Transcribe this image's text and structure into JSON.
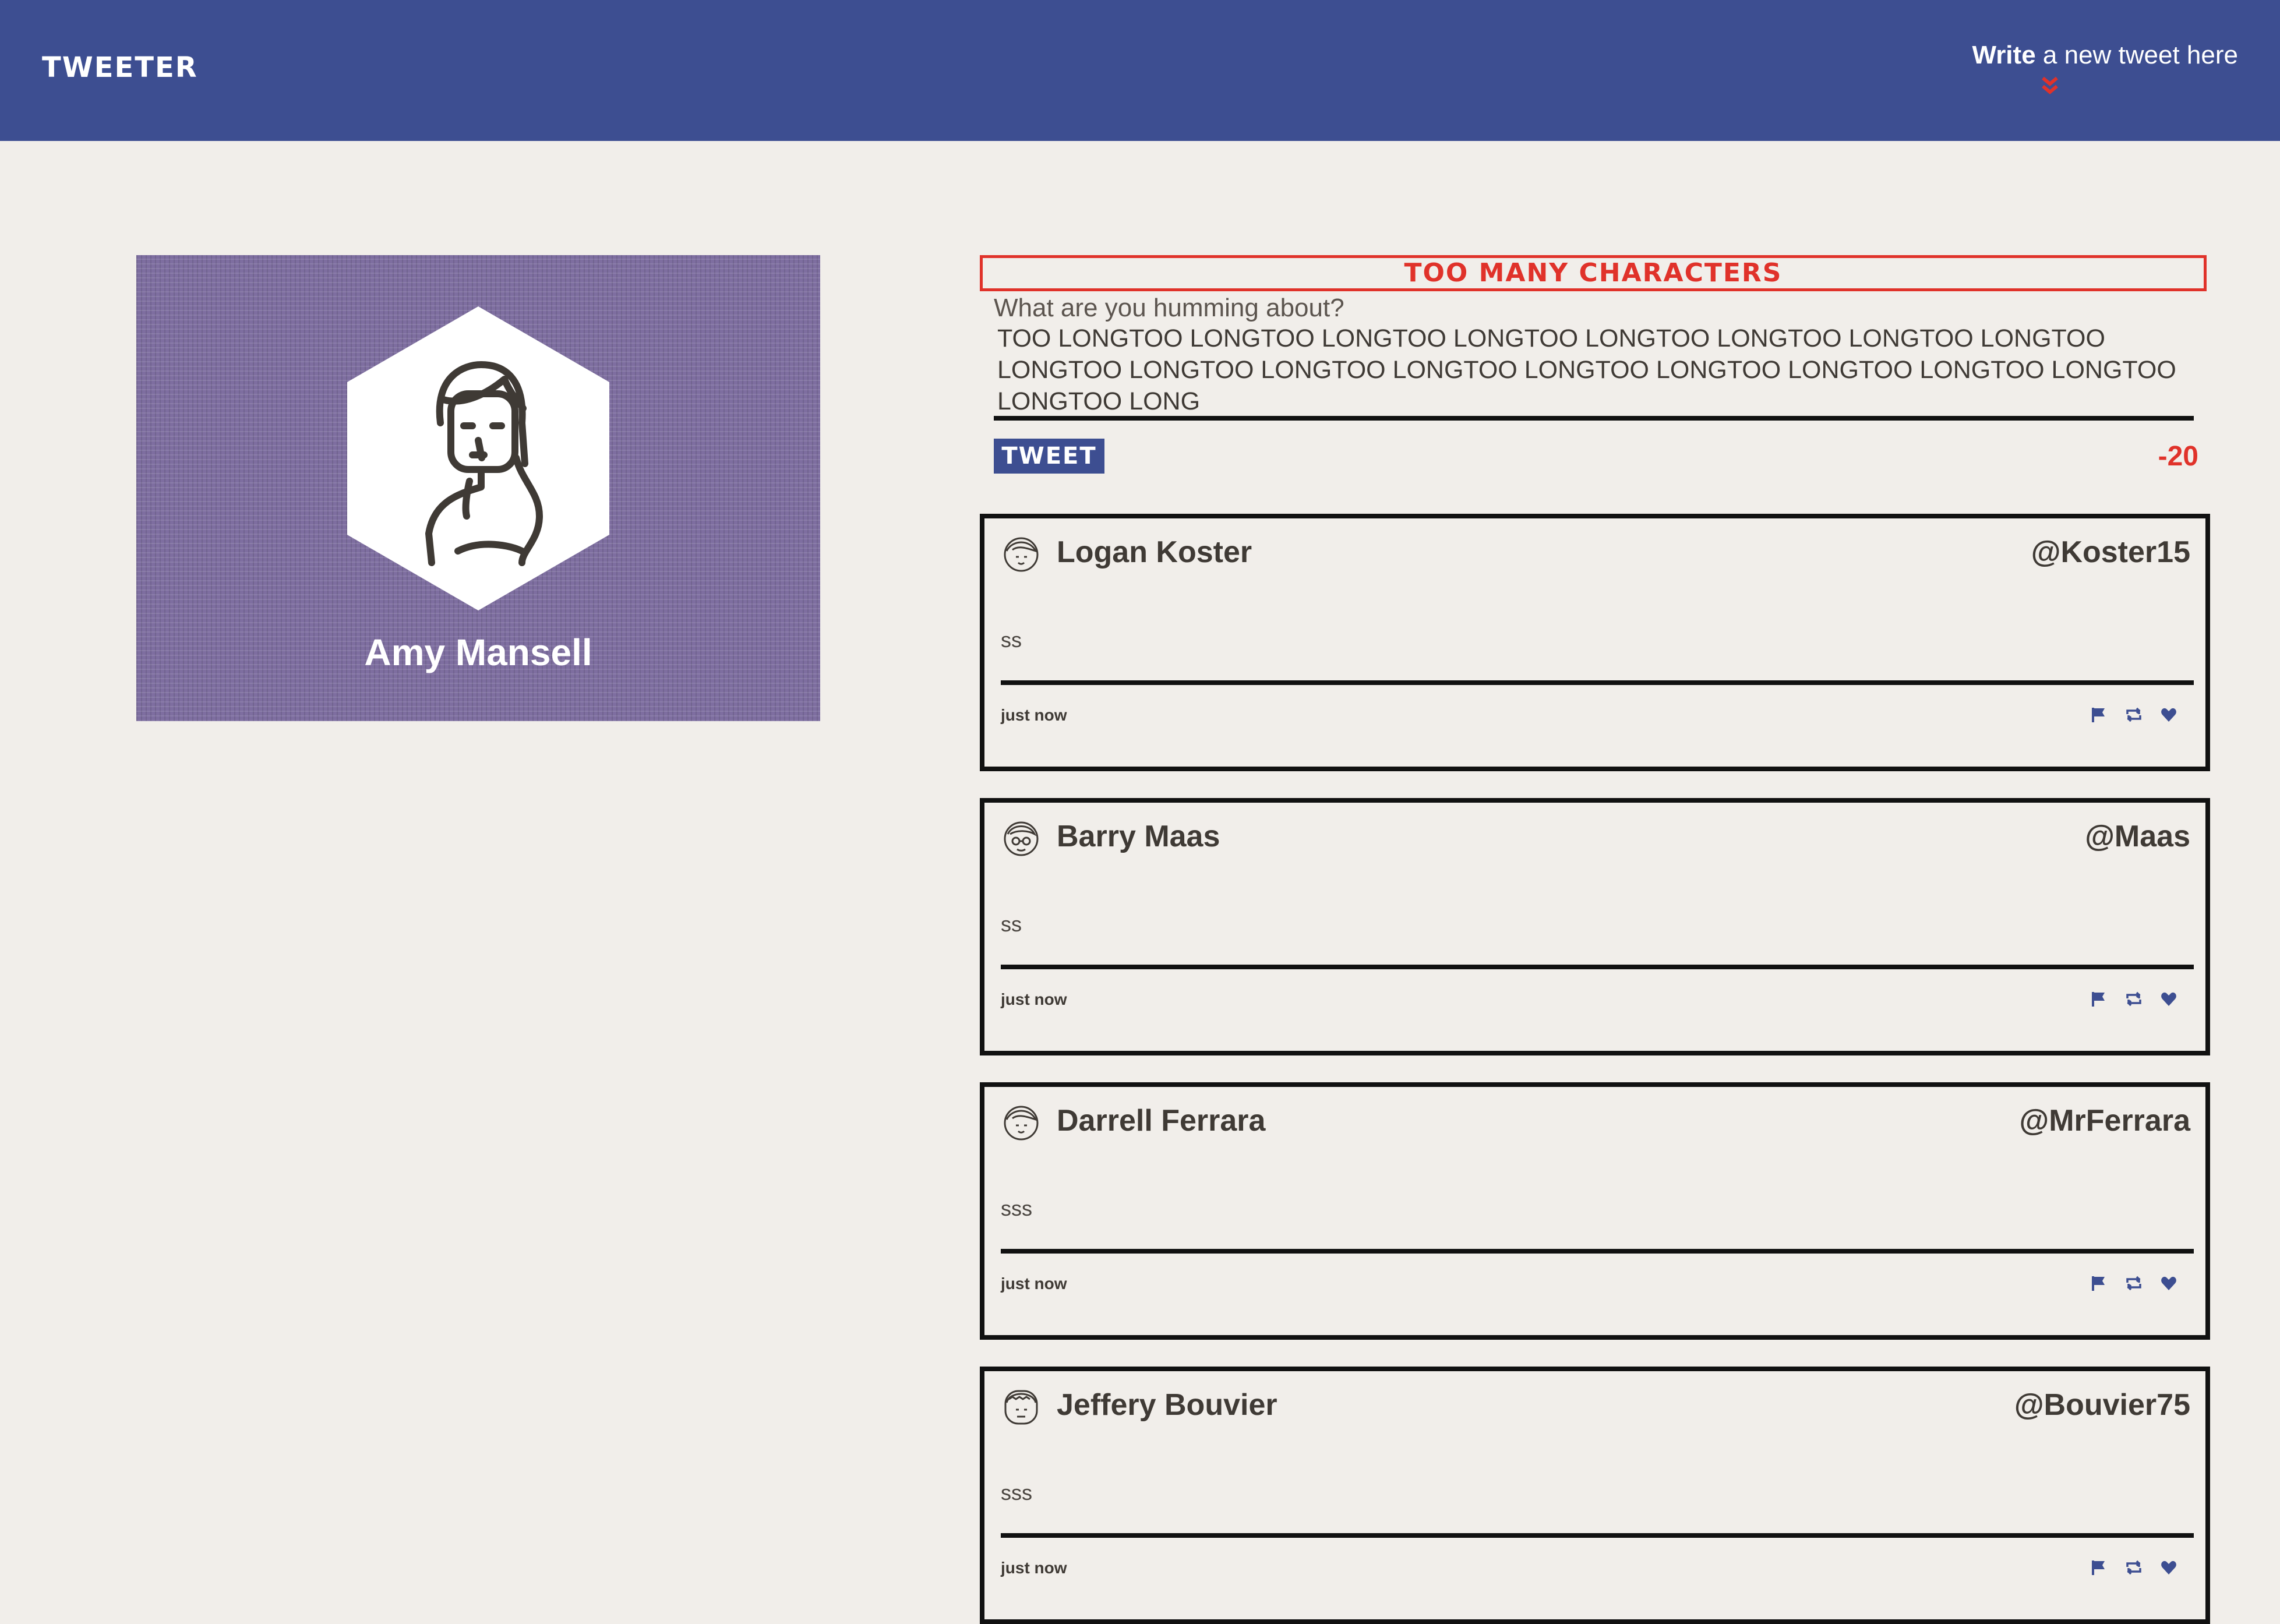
{
  "app": {
    "brand": "TWEETER"
  },
  "header": {
    "compose_strong": "Write",
    "compose_rest": " a new tweet here"
  },
  "profile": {
    "name": "Amy Mansell"
  },
  "compose": {
    "error": "Too many characters",
    "label": "What are you humming about?",
    "text": "TOO LONGTOO LONGTOO LONGTOO LONGTOO LONGTOO LONGTOO LONGTOO LONGTOO LONGTOO LONGTOO LONGTOO LONGTOO LONGTOO LONGTOO LONGTOO LONGTOO LONGTOO LONGTOO LONG",
    "button": "Tweet",
    "counter": "-20"
  },
  "colors": {
    "accent": "#3d4e91",
    "error": "#e0322a",
    "background": "#f1eeea",
    "profile_bg": "#7e6ea0"
  },
  "tweets": [
    {
      "name": "Logan Koster",
      "handle": "@Koster15",
      "body": "ss",
      "time": "just now"
    },
    {
      "name": "Barry Maas",
      "handle": "@Maas",
      "body": "ss",
      "time": "just now"
    },
    {
      "name": "Darrell Ferrara",
      "handle": "@MrFerrara",
      "body": "sss",
      "time": "just now"
    },
    {
      "name": "Jeffery Bouvier",
      "handle": "@Bouvier75",
      "body": "sss",
      "time": "just now"
    }
  ],
  "icons": {
    "flag": "flag-icon",
    "retweet": "retweet-icon",
    "like": "heart-icon"
  }
}
